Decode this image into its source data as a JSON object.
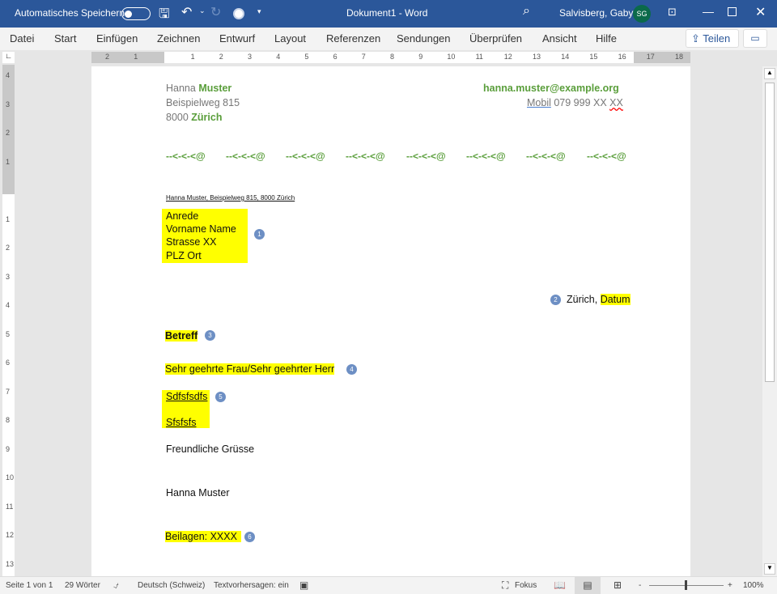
{
  "titlebar": {
    "autosave_label": "Automatisches Speichern",
    "title": "Dokument1  -  Word",
    "user": "Salvisberg, Gaby",
    "avatar_initials": "SG",
    "accent": "#2b579a"
  },
  "menu": {
    "items": [
      "Datei",
      "Start",
      "Einfügen",
      "Zeichnen",
      "Entwurf",
      "Layout",
      "Referenzen",
      "Sendungen",
      "Überprüfen",
      "Ansicht",
      "Hilfe"
    ],
    "share": "Teilen"
  },
  "ruler": {
    "h": [
      "2",
      "1",
      "",
      "1",
      "2",
      "3",
      "4",
      "5",
      "6",
      "7",
      "8",
      "9",
      "10",
      "11",
      "12",
      "13",
      "14",
      "15",
      "16",
      "17",
      "18"
    ],
    "v": [
      "4",
      "3",
      "2",
      "1",
      "",
      "1",
      "2",
      "3",
      "4",
      "5",
      "6",
      "7",
      "8",
      "9",
      "10",
      "11",
      "12",
      "13"
    ]
  },
  "letter": {
    "sender_first": "Hanna ",
    "sender_last": "Muster",
    "street": "Beispielweg 815",
    "zip": "8000 ",
    "city": "Zürich",
    "email": "hanna.muster@example.org",
    "mobil_label": "Mobil",
    "mobil_number": " 079 999 XX ",
    "mobil_xx": "XX",
    "separator": "--<-<-<@",
    "sender_line": "Hanna Muster, Beispielweg 815, 8000 Zürich",
    "address": [
      "Anrede",
      "Vorname Name",
      "Strasse XX",
      "PLZ Ort"
    ],
    "place": "Zürich, ",
    "date": "Datum",
    "subject": "Betreff",
    "salutation": "Sehr geehrte Frau/Sehr geehrter Herr",
    "body": [
      "Sdfsfsdfs",
      "Sfsfsfs"
    ],
    "closing": "Freundliche Grüsse",
    "signature": "Hanna Muster",
    "attachments": "Beilagen: XXXX",
    "badges": [
      "1",
      "2",
      "3",
      "4",
      "5",
      "6"
    ],
    "brand_green": "#5a9e3b",
    "highlight": "#ffff00"
  },
  "status": {
    "page": "Seite 1 von 1",
    "words": "29 Wörter",
    "language": "Deutsch (Schweiz)",
    "prediction": "Textvorhersagen: ein",
    "focus": "Fokus",
    "zoom": "100%",
    "zoom_minus": "-",
    "zoom_plus": "+"
  }
}
